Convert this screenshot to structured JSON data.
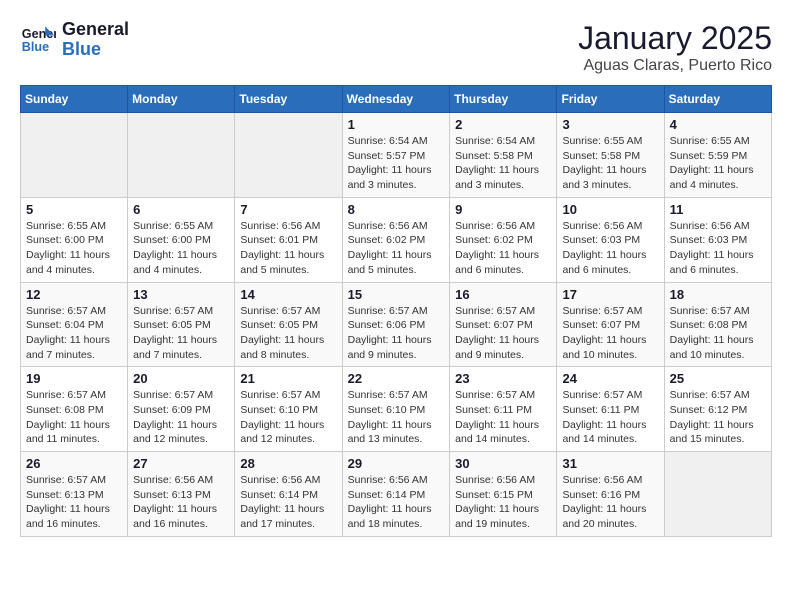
{
  "logo": {
    "line1": "General",
    "line2": "Blue"
  },
  "title": "January 2025",
  "subtitle": "Aguas Claras, Puerto Rico",
  "days_of_week": [
    "Sunday",
    "Monday",
    "Tuesday",
    "Wednesday",
    "Thursday",
    "Friday",
    "Saturday"
  ],
  "weeks": [
    [
      {
        "day": "",
        "info": ""
      },
      {
        "day": "",
        "info": ""
      },
      {
        "day": "",
        "info": ""
      },
      {
        "day": "1",
        "info": "Sunrise: 6:54 AM\nSunset: 5:57 PM\nDaylight: 11 hours and 3 minutes."
      },
      {
        "day": "2",
        "info": "Sunrise: 6:54 AM\nSunset: 5:58 PM\nDaylight: 11 hours and 3 minutes."
      },
      {
        "day": "3",
        "info": "Sunrise: 6:55 AM\nSunset: 5:58 PM\nDaylight: 11 hours and 3 minutes."
      },
      {
        "day": "4",
        "info": "Sunrise: 6:55 AM\nSunset: 5:59 PM\nDaylight: 11 hours and 4 minutes."
      }
    ],
    [
      {
        "day": "5",
        "info": "Sunrise: 6:55 AM\nSunset: 6:00 PM\nDaylight: 11 hours and 4 minutes."
      },
      {
        "day": "6",
        "info": "Sunrise: 6:55 AM\nSunset: 6:00 PM\nDaylight: 11 hours and 4 minutes."
      },
      {
        "day": "7",
        "info": "Sunrise: 6:56 AM\nSunset: 6:01 PM\nDaylight: 11 hours and 5 minutes."
      },
      {
        "day": "8",
        "info": "Sunrise: 6:56 AM\nSunset: 6:02 PM\nDaylight: 11 hours and 5 minutes."
      },
      {
        "day": "9",
        "info": "Sunrise: 6:56 AM\nSunset: 6:02 PM\nDaylight: 11 hours and 6 minutes."
      },
      {
        "day": "10",
        "info": "Sunrise: 6:56 AM\nSunset: 6:03 PM\nDaylight: 11 hours and 6 minutes."
      },
      {
        "day": "11",
        "info": "Sunrise: 6:56 AM\nSunset: 6:03 PM\nDaylight: 11 hours and 6 minutes."
      }
    ],
    [
      {
        "day": "12",
        "info": "Sunrise: 6:57 AM\nSunset: 6:04 PM\nDaylight: 11 hours and 7 minutes."
      },
      {
        "day": "13",
        "info": "Sunrise: 6:57 AM\nSunset: 6:05 PM\nDaylight: 11 hours and 7 minutes."
      },
      {
        "day": "14",
        "info": "Sunrise: 6:57 AM\nSunset: 6:05 PM\nDaylight: 11 hours and 8 minutes."
      },
      {
        "day": "15",
        "info": "Sunrise: 6:57 AM\nSunset: 6:06 PM\nDaylight: 11 hours and 9 minutes."
      },
      {
        "day": "16",
        "info": "Sunrise: 6:57 AM\nSunset: 6:07 PM\nDaylight: 11 hours and 9 minutes."
      },
      {
        "day": "17",
        "info": "Sunrise: 6:57 AM\nSunset: 6:07 PM\nDaylight: 11 hours and 10 minutes."
      },
      {
        "day": "18",
        "info": "Sunrise: 6:57 AM\nSunset: 6:08 PM\nDaylight: 11 hours and 10 minutes."
      }
    ],
    [
      {
        "day": "19",
        "info": "Sunrise: 6:57 AM\nSunset: 6:08 PM\nDaylight: 11 hours and 11 minutes."
      },
      {
        "day": "20",
        "info": "Sunrise: 6:57 AM\nSunset: 6:09 PM\nDaylight: 11 hours and 12 minutes."
      },
      {
        "day": "21",
        "info": "Sunrise: 6:57 AM\nSunset: 6:10 PM\nDaylight: 11 hours and 12 minutes."
      },
      {
        "day": "22",
        "info": "Sunrise: 6:57 AM\nSunset: 6:10 PM\nDaylight: 11 hours and 13 minutes."
      },
      {
        "day": "23",
        "info": "Sunrise: 6:57 AM\nSunset: 6:11 PM\nDaylight: 11 hours and 14 minutes."
      },
      {
        "day": "24",
        "info": "Sunrise: 6:57 AM\nSunset: 6:11 PM\nDaylight: 11 hours and 14 minutes."
      },
      {
        "day": "25",
        "info": "Sunrise: 6:57 AM\nSunset: 6:12 PM\nDaylight: 11 hours and 15 minutes."
      }
    ],
    [
      {
        "day": "26",
        "info": "Sunrise: 6:57 AM\nSunset: 6:13 PM\nDaylight: 11 hours and 16 minutes."
      },
      {
        "day": "27",
        "info": "Sunrise: 6:56 AM\nSunset: 6:13 PM\nDaylight: 11 hours and 16 minutes."
      },
      {
        "day": "28",
        "info": "Sunrise: 6:56 AM\nSunset: 6:14 PM\nDaylight: 11 hours and 17 minutes."
      },
      {
        "day": "29",
        "info": "Sunrise: 6:56 AM\nSunset: 6:14 PM\nDaylight: 11 hours and 18 minutes."
      },
      {
        "day": "30",
        "info": "Sunrise: 6:56 AM\nSunset: 6:15 PM\nDaylight: 11 hours and 19 minutes."
      },
      {
        "day": "31",
        "info": "Sunrise: 6:56 AM\nSunset: 6:16 PM\nDaylight: 11 hours and 20 minutes."
      },
      {
        "day": "",
        "info": ""
      }
    ]
  ]
}
